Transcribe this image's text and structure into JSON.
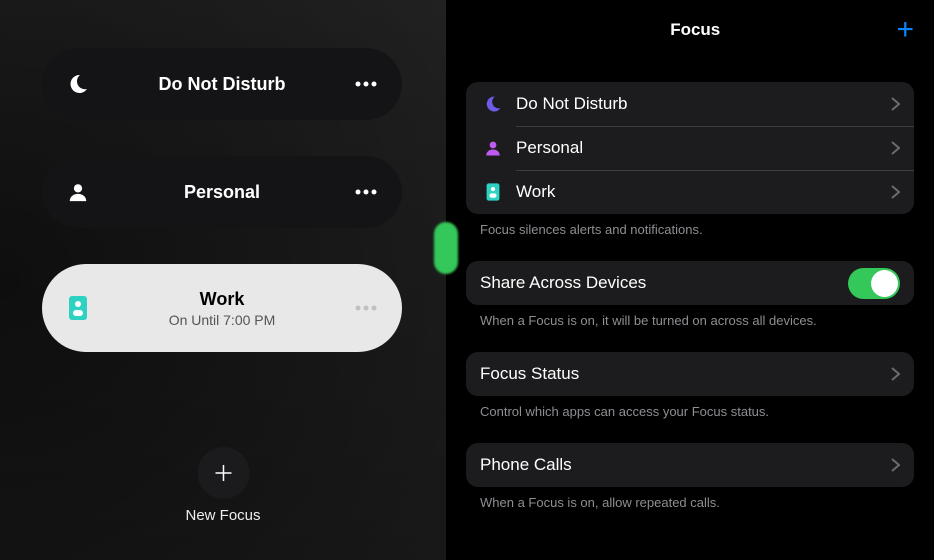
{
  "left": {
    "pills": [
      {
        "title": "Do Not Disturb",
        "sub": "",
        "icon": "moon",
        "active": false
      },
      {
        "title": "Personal",
        "sub": "",
        "icon": "person",
        "active": false
      },
      {
        "title": "Work",
        "sub": "On Until 7:00 PM",
        "icon": "badge",
        "active": true
      }
    ],
    "new_focus_label": "New Focus"
  },
  "right": {
    "title": "Focus",
    "list": [
      {
        "label": "Do Not Disturb",
        "icon": "moon",
        "icon_color": "#6e5ce6"
      },
      {
        "label": "Personal",
        "icon": "person",
        "icon_color": "#bf5af2"
      },
      {
        "label": "Work",
        "icon": "badge",
        "icon_color": "#2dd2c3"
      }
    ],
    "list_footer": "Focus silences alerts and notifications.",
    "share": {
      "label": "Share Across Devices",
      "footer": "When a Focus is on, it will be turned on across all devices.",
      "on": true
    },
    "status": {
      "label": "Focus Status",
      "footer": "Control which apps can access your Focus status."
    },
    "phone": {
      "label": "Phone Calls",
      "footer": "When a Focus is on, allow repeated calls."
    }
  }
}
